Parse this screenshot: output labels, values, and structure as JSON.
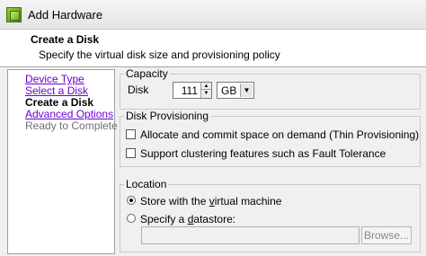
{
  "window": {
    "title": "Add Hardware",
    "icon": "vm-hardware-icon"
  },
  "header": {
    "title": "Create a Disk",
    "subtitle": "Specify the virtual disk size and provisioning policy"
  },
  "nav": {
    "items": [
      {
        "label": "Device Type",
        "state": "link"
      },
      {
        "label": "Select a Disk",
        "state": "link"
      },
      {
        "label": "Create a Disk",
        "state": "current"
      },
      {
        "label": "Advanced Options",
        "state": "link"
      },
      {
        "label": "Ready to Complete",
        "state": "future"
      }
    ]
  },
  "capacity": {
    "group_label": "Capacity",
    "disk_label": "Disk",
    "disk_size": "111",
    "unit": "GB"
  },
  "provisioning": {
    "group_label": "Disk Provisioning",
    "thin": {
      "label": "Allocate and commit space on demand (Thin Provisioning)",
      "checked": false
    },
    "fault_tolerance": {
      "label": "Support clustering features such as Fault Tolerance",
      "checked": false
    }
  },
  "location": {
    "group_label": "Location",
    "store_with_vm": {
      "prefix": "Store with the ",
      "underlined": "v",
      "suffix": "irtual machine",
      "selected": true
    },
    "specify_datastore": {
      "prefix": "Specify a ",
      "underlined": "d",
      "suffix": "atastore:",
      "selected": false
    },
    "datastore_value": "",
    "browse_label": "Browse..."
  }
}
